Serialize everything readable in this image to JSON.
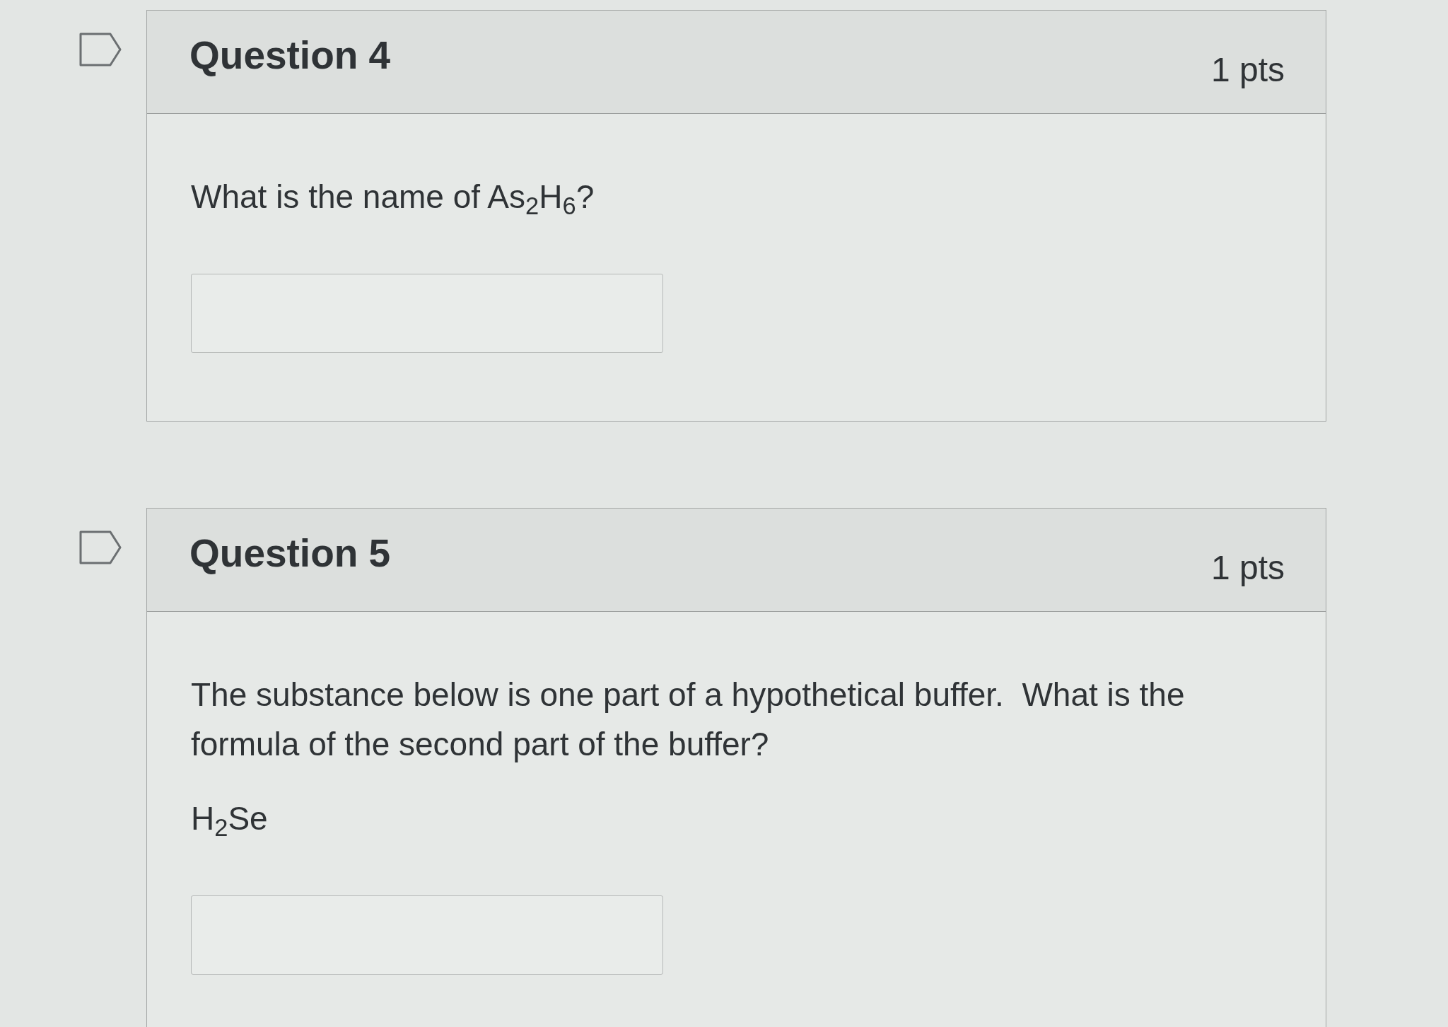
{
  "questions": [
    {
      "title": "Question 4",
      "points": "1 pts",
      "flagged": false,
      "prompt": [
        "What is the name of As$_{2}$H$_{6}$?"
      ],
      "answer": {
        "kind": "text"
      }
    },
    {
      "title": "Question 5",
      "points": "1 pts",
      "flagged": false,
      "prompt": [
        "The substance below is one part of a hypothetical buffer.  What is the formula of the second part of the buffer?",
        "H$_{2}$Se"
      ],
      "answer": {
        "kind": "text"
      }
    }
  ]
}
